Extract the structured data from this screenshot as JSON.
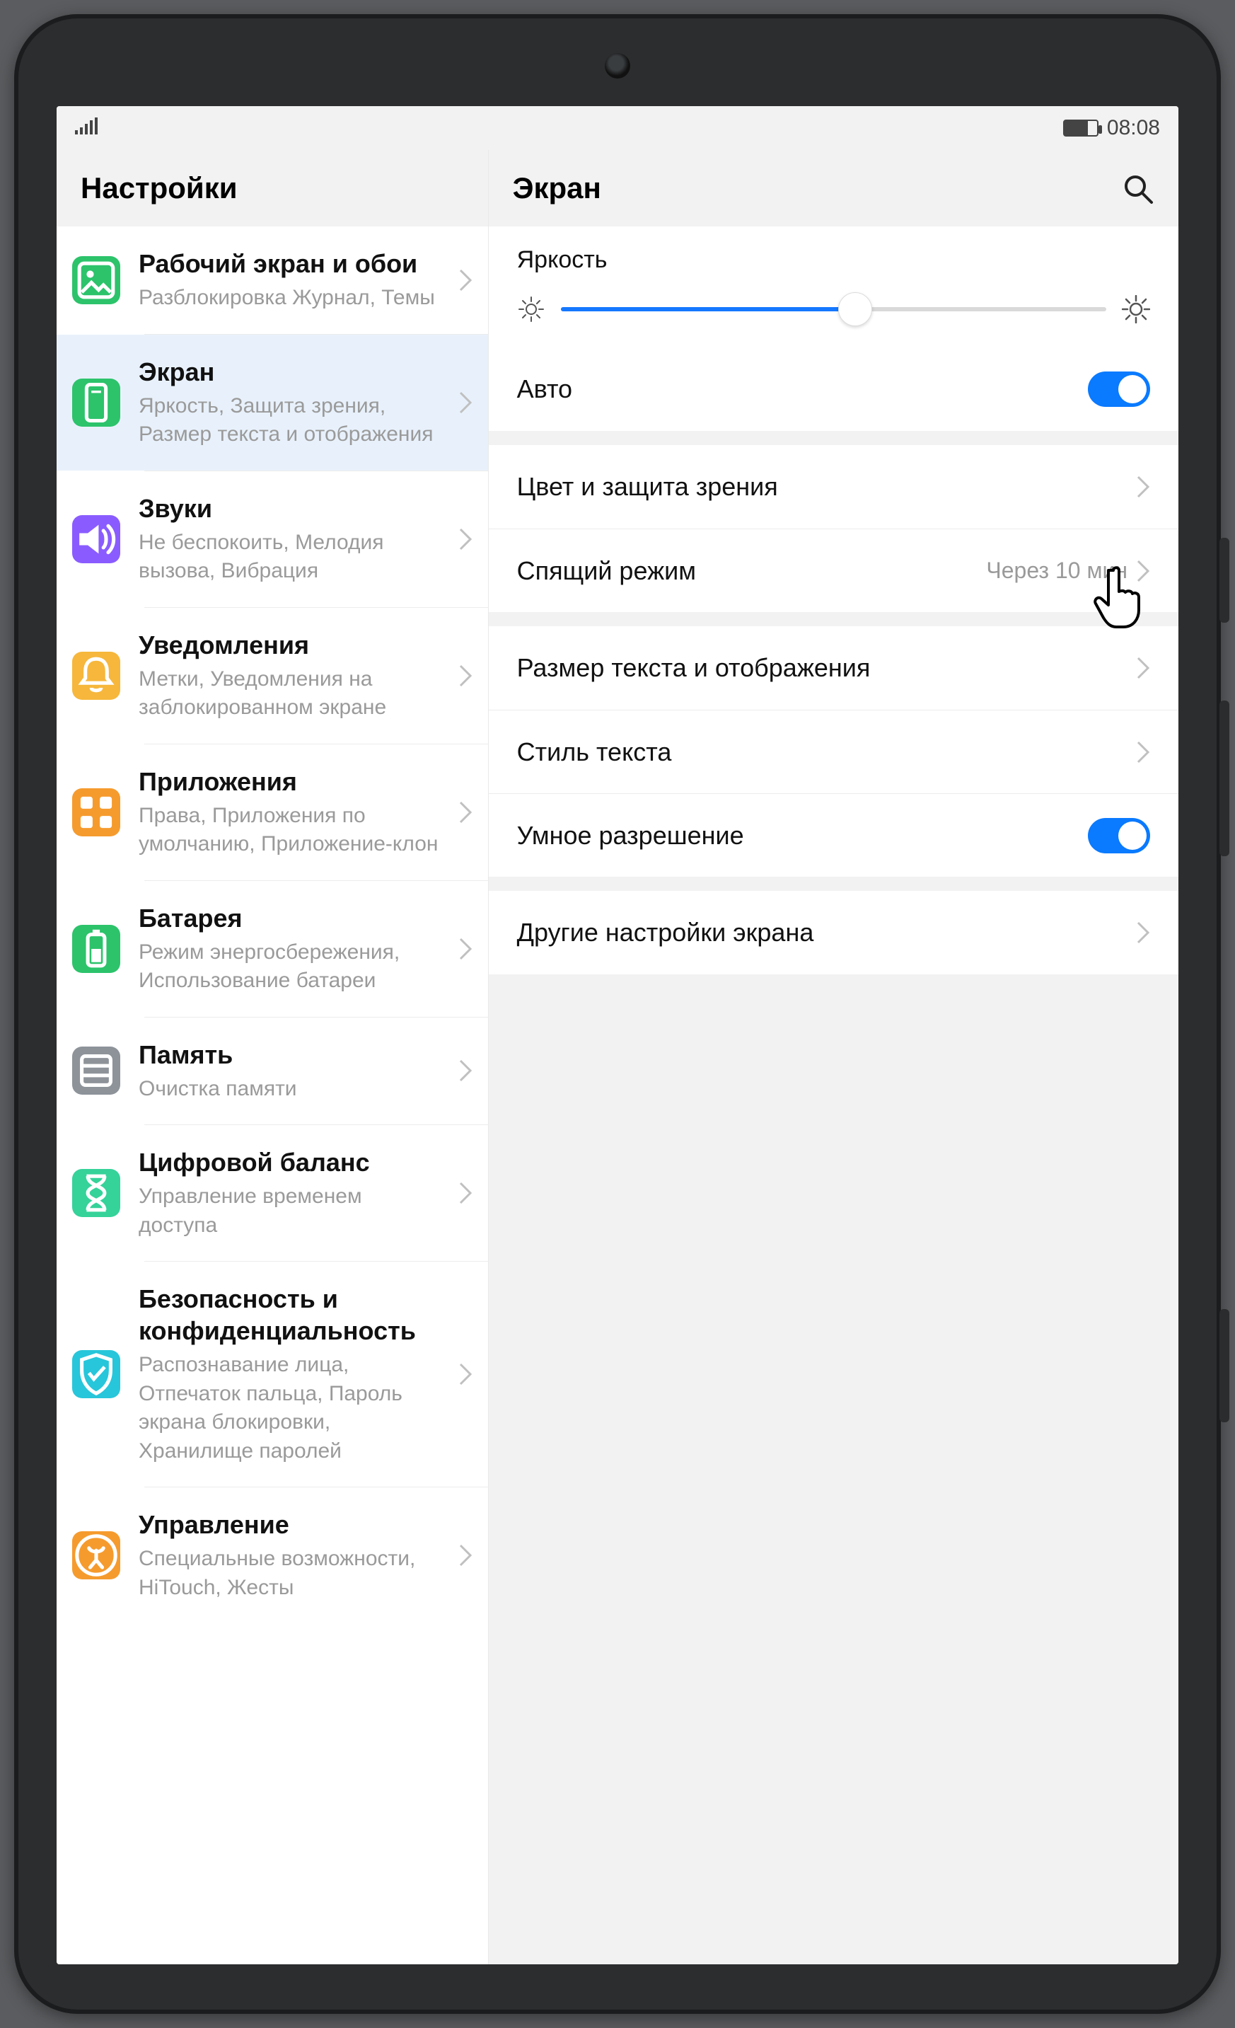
{
  "status": {
    "time": "08:08"
  },
  "sidebar": {
    "title": "Настройки",
    "items": [
      {
        "title": "Рабочий экран и обои",
        "sub": "Разблокировка Журнал, Темы",
        "icon": "wallpaper",
        "color": "#2cc36b"
      },
      {
        "title": "Экран",
        "sub": "Яркость, Защита зрения, Размер текста и отображения",
        "icon": "display",
        "color": "#2cc36b",
        "selected": true
      },
      {
        "title": "Звуки",
        "sub": "Не беспокоить, Мелодия вызова, Вибрация",
        "icon": "sound",
        "color": "#8a5cff"
      },
      {
        "title": "Уведомления",
        "sub": "Метки, Уведомления на заблокированном экране",
        "icon": "bell",
        "color": "#f6b73c"
      },
      {
        "title": "Приложения",
        "sub": "Права, Приложения по умолчанию, Приложение-клон",
        "icon": "apps",
        "color": "#f59b2e"
      },
      {
        "title": "Батарея",
        "sub": "Режим энергосбере­жения, Использование батареи",
        "icon": "battery",
        "color": "#2cc36b"
      },
      {
        "title": "Память",
        "sub": "Очистка памяти",
        "icon": "storage",
        "color": "#8d9399"
      },
      {
        "title": "Цифровой баланс",
        "sub": "Управление временем доступа",
        "icon": "hourglass",
        "color": "#35d29a"
      },
      {
        "title": "Безопасность и конфиденциаль­ность",
        "sub": "Распознавание лица, Отпечаток пальца, Пароль экрана бло­кировки, Хранилище паролей",
        "icon": "shield",
        "color": "#27c6da"
      },
      {
        "title": "Управление",
        "sub": "Специальные возможности, HiTouch, Жесты",
        "icon": "accessibility",
        "color": "#f59b2e"
      }
    ]
  },
  "main": {
    "title": "Экран",
    "brightness_label": "Яркость",
    "brightness_percent": 54,
    "auto_label": "Авто",
    "auto_on": true,
    "rows": {
      "color": {
        "label": "Цвет и защита зрения"
      },
      "sleep": {
        "label": "Спящий режим",
        "value": "Через 10 мин"
      },
      "textsize": {
        "label": "Размер текста и отображения"
      },
      "font": {
        "label": "Стиль текста"
      },
      "smartres": {
        "label": "Умное разрешение",
        "on": true
      },
      "other": {
        "label": "Другие настройки экрана"
      }
    }
  }
}
